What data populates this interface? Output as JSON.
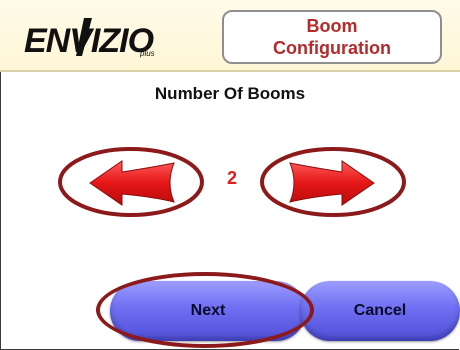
{
  "header": {
    "logo_text": "ENVIZIO",
    "logo_suffix": "plus",
    "title_line1": "Boom",
    "title_line2": "Configuration"
  },
  "main": {
    "heading": "Number Of Booms",
    "boom_count": "2"
  },
  "buttons": {
    "next_label": "Next",
    "cancel_label": "Cancel"
  },
  "colors": {
    "arrow_red": "#e51616",
    "title_red": "#b52a2a",
    "button_blue": "#6f6ff2",
    "highlight_ring": "#8c1a1a"
  },
  "icons": [
    "envizio-logo",
    "left-arrow-icon",
    "right-arrow-icon"
  ]
}
